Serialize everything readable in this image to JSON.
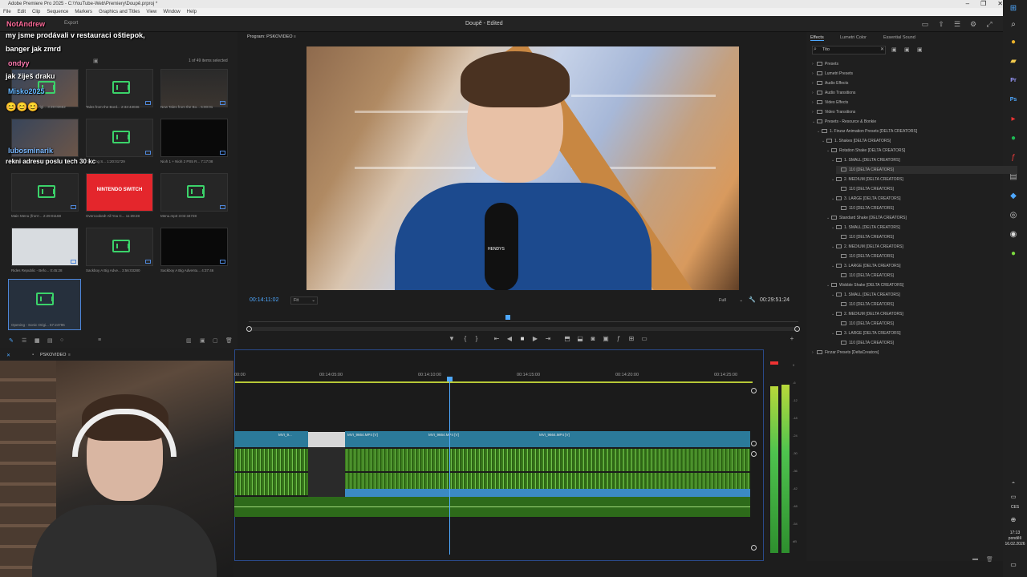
{
  "titlebar": {
    "title": "Adobe Premiere Pro 2025 - C:\\YouTube-Web\\Premiery\\Doupě.prproj *"
  },
  "menu": [
    "File",
    "Edit",
    "Clip",
    "Sequence",
    "Markers",
    "Graphics and Titles",
    "View",
    "Window",
    "Help"
  ],
  "appbar": {
    "import": "Export",
    "title": "Doupě - Edited"
  },
  "chat": [
    {
      "user": "NotAndrew",
      "text": ""
    },
    {
      "user": "",
      "text": "my jsme prodávali v restauraci oštiepok,"
    },
    {
      "user": "",
      "text": "banger jak zmrd"
    },
    {
      "user": "ondyy",
      "text": ""
    },
    {
      "user": "",
      "text": "jak žiješ draku"
    },
    {
      "user": "Misko2025",
      "text": ""
    },
    {
      "user": "lubosminarik",
      "text": ""
    },
    {
      "user": "",
      "text": "rekni adresu poslu tech 30 kc"
    }
  ],
  "project": {
    "items_selected": "1 of 49 items selected",
    "tiles": [
      {
        "label": "Opening Sonic Origi... 3:39:03662"
      },
      {
        "label": "Tales from the Bord... 2:32:43036"
      },
      {
        "label": "New Tales from the Bo... 6:00:01"
      },
      {
        "label": "Opening S... 1:20:01729"
      },
      {
        "label": "Opening S... 1:20:01729"
      },
      {
        "label": "Nioh 1 + Nioh 2 PS5 R... 7:17:08"
      },
      {
        "label": "Main Menu (from'... 2:29:01168"
      },
      {
        "label": "Overcooked! All You C... 11:39:28",
        "text": "NINTENDO SWITCH"
      },
      {
        "label": "Menu.mp3 3:02:34728"
      },
      {
        "label": "Rides Republic - Befo... 0:45:28"
      },
      {
        "label": "Sackboy A Big Adve... 3:56:03280"
      },
      {
        "label": "Sackboy A Big Adventu... 4:37:46"
      },
      {
        "label": "Opening - Sonic Origi... 57:24796"
      }
    ]
  },
  "program": {
    "tab": "Program: PSKOVIDEO",
    "timecode_current": "00:14:11:02",
    "fit": "Fit",
    "resolution": "Full",
    "timecode_total": "00:29:51:24",
    "mic_text": "HENDYS"
  },
  "effects": {
    "tabs": [
      "Effects",
      "Lumetri Color",
      "Essential Sound"
    ],
    "search": "Tito",
    "tree": [
      {
        "label": "Presets",
        "level": 0,
        "arrow": ">"
      },
      {
        "label": "Lumetri Presets",
        "level": 0,
        "arrow": ">"
      },
      {
        "label": "Audio Effects",
        "level": 0,
        "arrow": ">"
      },
      {
        "label": "Audio Transitions",
        "level": 0,
        "arrow": ">"
      },
      {
        "label": "Video Effects",
        "level": 0,
        "arrow": ">"
      },
      {
        "label": "Video Transitions",
        "level": 0,
        "arrow": ">"
      },
      {
        "label": "Presets - Resource & Bonkie",
        "level": 0,
        "arrow": "v"
      },
      {
        "label": "1. Finzar Animation Presets [DELTA CREATORS]",
        "level": 1,
        "arrow": "v"
      },
      {
        "label": "1. Shakes [DELTA CREATORS]",
        "level": 2,
        "arrow": "v"
      },
      {
        "label": "Rotation Shake [DELTA CREATORS]",
        "level": 3,
        "arrow": "v"
      },
      {
        "label": "1. SMALL [DELTA CREATORS]",
        "level": 4,
        "arrow": "v"
      },
      {
        "label": "110 [DELTA CREATORS]",
        "level": 5,
        "arrow": ""
      },
      {
        "label": "2. MEDIUM [DELTA CREATORS]",
        "level": 4,
        "arrow": "v"
      },
      {
        "label": "110 [DELTA CREATORS]",
        "level": 5,
        "arrow": ""
      },
      {
        "label": "3. LARGE [DELTA CREATORS]",
        "level": 4,
        "arrow": "v"
      },
      {
        "label": "110 [DELTA CREATORS]",
        "level": 5,
        "arrow": ""
      },
      {
        "label": "Standard Shake [DELTA CREATORS]",
        "level": 3,
        "arrow": "v"
      },
      {
        "label": "1. SMALL [DELTA CREATORS]",
        "level": 4,
        "arrow": "v"
      },
      {
        "label": "110 [DELTA CREATORS]",
        "level": 5,
        "arrow": ""
      },
      {
        "label": "2. MEDIUM [DELTA CREATORS]",
        "level": 4,
        "arrow": "v"
      },
      {
        "label": "110 [DELTA CREATORS]",
        "level": 5,
        "arrow": ""
      },
      {
        "label": "3. LARGE [DELTA CREATORS]",
        "level": 4,
        "arrow": "v"
      },
      {
        "label": "110 [DELTA CREATORS]",
        "level": 5,
        "arrow": ""
      },
      {
        "label": "Wobble Shake [DELTA CREATORS]",
        "level": 3,
        "arrow": "v"
      },
      {
        "label": "1. SMALL [DELTA CREATORS]",
        "level": 4,
        "arrow": "v"
      },
      {
        "label": "110 [DELTA CREATORS]",
        "level": 5,
        "arrow": ""
      },
      {
        "label": "2. MEDIUM [DELTA CREATORS]",
        "level": 4,
        "arrow": "v"
      },
      {
        "label": "110 [DELTA CREATORS]",
        "level": 5,
        "arrow": ""
      },
      {
        "label": "3. LARGE [DELTA CREATORS]",
        "level": 4,
        "arrow": "v"
      },
      {
        "label": "110 [DELTA CREATORS]",
        "level": 5,
        "arrow": ""
      },
      {
        "label": "Finzar Presets [DeltaCreators]",
        "level": 0,
        "arrow": ">"
      }
    ]
  },
  "timeline": {
    "sequence_tab": "PSKOVIDEO",
    "times": [
      "00:00",
      "00:14:05:00",
      "00:14:10:00",
      "00:14:15:00",
      "00:14:20:00",
      "00:14:25:00"
    ],
    "clips": [
      {
        "label": "MVI_9..."
      },
      {
        "label": "MVI_9664.MP4 [V]"
      },
      {
        "label": "MVI_9664.MP4 [V]"
      },
      {
        "label": "MVI_9664.MP4 [V]"
      }
    ]
  },
  "meters": {
    "scale": [
      "0",
      "-6",
      "-12",
      "-18",
      "-24",
      "-30",
      "-36",
      "-42",
      "-48",
      "-54",
      "dB"
    ]
  },
  "clock": {
    "time": "17:13",
    "day": "pondělí",
    "date": "16.02.2026",
    "lang": "CES"
  },
  "colors": {
    "accent": "#4ea8ff",
    "audio": "#3bd36a",
    "video_clip": "#2b7a9a",
    "work_area": "#b7c837"
  }
}
